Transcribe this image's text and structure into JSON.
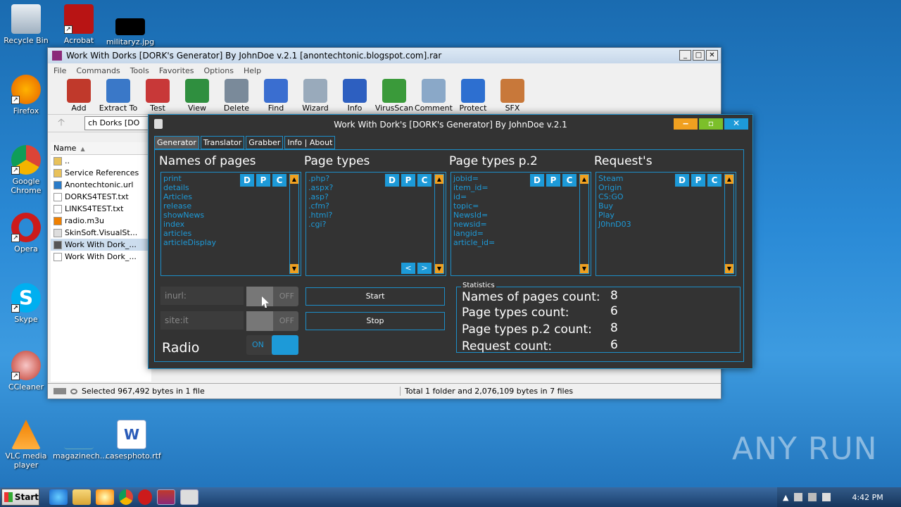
{
  "desktop": {
    "icons": [
      {
        "id": "recycle",
        "label": "Recycle Bin",
        "color": "#cfd8e0"
      },
      {
        "id": "acrobat",
        "label": "Acrobat",
        "color": "#b81414"
      },
      {
        "id": "militaryz",
        "label": "militaryz.jpg",
        "color": "#000000"
      },
      {
        "id": "firefox",
        "label": "Firefox",
        "color": "#e66000"
      },
      {
        "id": "chrome",
        "label": "Google Chrome",
        "color": "#4c8bf5"
      },
      {
        "id": "opera",
        "label": "Opera",
        "color": "#cc1b1b"
      },
      {
        "id": "skype",
        "label": "Skype",
        "color": "#00aff0"
      },
      {
        "id": "ccleaner",
        "label": "CCleaner",
        "color": "#c0392b"
      },
      {
        "id": "vlc",
        "label": "VLC media player",
        "color": "#f08000"
      },
      {
        "id": "magazinech",
        "label": "magazinech...",
        "color": "#2a7bc8"
      },
      {
        "id": "casesphoto",
        "label": "casesphoto.rtf",
        "color": "#ffffff"
      }
    ],
    "watermark": "ANY RUN"
  },
  "rar": {
    "title": "Work With Dorks [DORK's Generator] By JohnDoe v.2.1 [anontechtonic.blogspot.com].rar",
    "menu": [
      "File",
      "Commands",
      "Tools",
      "Favorites",
      "Options",
      "Help"
    ],
    "toolbar": [
      {
        "label": "Add",
        "color": "#c0392b"
      },
      {
        "label": "Extract To",
        "color": "#3a78c8"
      },
      {
        "label": "Test",
        "color": "#c83838"
      },
      {
        "label": "View",
        "color": "#2f8f3f"
      },
      {
        "label": "Delete",
        "color": "#7a8a9a"
      },
      {
        "label": "Find",
        "color": "#3a6ed0"
      },
      {
        "label": "Wizard",
        "color": "#9ab"
      },
      {
        "label": "Info",
        "color": "#2d5fc0"
      },
      {
        "label": "VirusScan",
        "color": "#3a9a3a"
      },
      {
        "label": "Comment",
        "color": "#8aa8c8"
      },
      {
        "label": "Protect",
        "color": "#2d6fd0"
      },
      {
        "label": "SFX",
        "color": "#c8783a"
      }
    ],
    "address": "ch Dorks [DO",
    "col_name": "Name",
    "files": [
      {
        "name": "..",
        "icon": "folder"
      },
      {
        "name": "Service References",
        "icon": "folder"
      },
      {
        "name": "Anontechtonic.url",
        "icon": "url"
      },
      {
        "name": "DORKS4TEST.txt",
        "icon": "text"
      },
      {
        "name": "LINKS4TEST.txt",
        "icon": "text"
      },
      {
        "name": "radio.m3u",
        "icon": "vlc"
      },
      {
        "name": "SkinSoft.VisualSt...",
        "icon": "dll"
      },
      {
        "name": "Work With Dork_...",
        "icon": "app"
      },
      {
        "name": "Work With Dork_...",
        "icon": "config"
      }
    ],
    "selected_index": 7,
    "status_left": "Selected 967,492 bytes in 1 file",
    "status_right": "Total 1 folder and 2,076,109 bytes in 7 files"
  },
  "dork": {
    "title": "Work With Dork's [DORK's Generator] By JohnDoe v.2.1",
    "tabs": [
      "Generator",
      "Translator",
      "Grabber",
      "Info | About"
    ],
    "columns": [
      {
        "title": "Names of pages",
        "items": [
          "print",
          "details",
          "Articles",
          "release",
          "showNews",
          "index",
          "articles",
          "articleDisplay"
        ]
      },
      {
        "title": "Page types",
        "items": [
          ".php?",
          ".aspx?",
          ".asp?",
          ".cfm?",
          ".html?",
          ".cgi?"
        ]
      },
      {
        "title": "Page types p.2",
        "items": [
          "jobid=",
          "item_id=",
          "id=",
          "topic=",
          "NewsId=",
          "newsid=",
          "langid=",
          "article_id="
        ]
      },
      {
        "title": "Request's",
        "items": [
          "Steam",
          "Origin",
          "CS:GO",
          "Buy",
          "Play",
          "J0hnD03"
        ]
      }
    ],
    "dpc": [
      "D",
      "P",
      "C"
    ],
    "nav": [
      "<",
      ">"
    ],
    "inurl_placeholder": "inurl:",
    "site_placeholder": "site:it",
    "toggle_off": "OFF",
    "toggle_on": "ON",
    "radio_label": "Radio",
    "start": "Start",
    "stop": "Stop",
    "stats": {
      "legend": "Statistics",
      "rows": [
        {
          "label": "Names of pages count:",
          "value": "8"
        },
        {
          "label": "Page types count:",
          "value": "6"
        },
        {
          "label": "Page types p.2 count:",
          "value": "8"
        },
        {
          "label": "Request count:",
          "value": "6"
        }
      ]
    },
    "accent": "#1d9ad8"
  },
  "taskbar": {
    "start": "Start",
    "time": "4:42 PM"
  }
}
